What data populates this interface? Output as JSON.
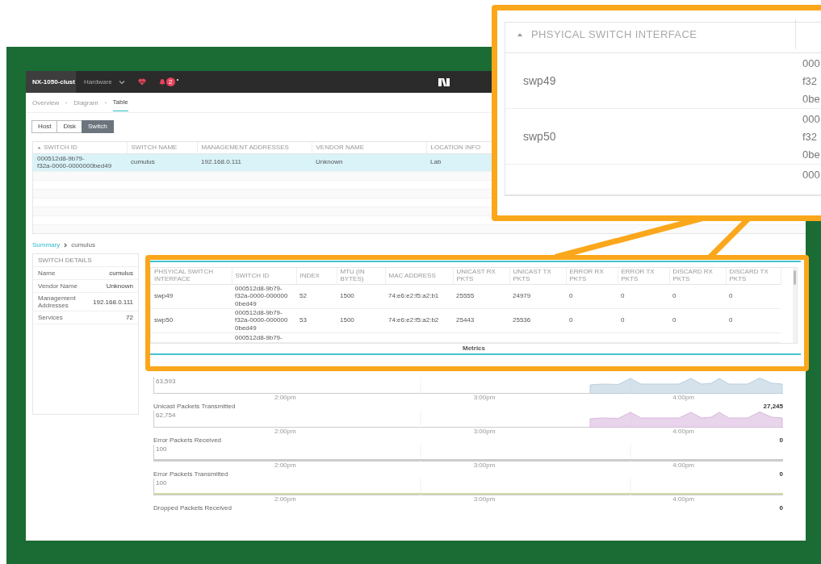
{
  "app": {
    "header": {
      "cluster": "NX-1050-clust",
      "menu": "Hardware",
      "alert_count": "2"
    },
    "tabs": [
      {
        "label": "Overview",
        "selected": false
      },
      {
        "label": "Diagram",
        "selected": false
      },
      {
        "label": "Table",
        "selected": true
      }
    ],
    "entity_buttons": [
      {
        "label": "Host",
        "selected": false
      },
      {
        "label": "Disk",
        "selected": false
      },
      {
        "label": "Switch",
        "selected": true
      }
    ],
    "switch_table": {
      "columns": [
        "SWITCH ID",
        "SWITCH NAME",
        "MANAGEMENT ADDRESSES",
        "VENDOR NAME",
        "LOCATION INFO"
      ],
      "rows": [
        {
          "selected": true,
          "cells": [
            [
              "000512d8-9b79-",
              "f32a-0000-0000000bed49"
            ],
            [
              "cumulus"
            ],
            [
              "192.168.0.111"
            ],
            [
              "Unknown"
            ],
            [
              "Lab"
            ]
          ]
        }
      ]
    },
    "breadcrumb": {
      "link": "Summary",
      "current": "cumulus"
    },
    "switch_details": {
      "title": "SWITCH DETAILS",
      "rows": [
        {
          "label": "Name",
          "value": "cumulus"
        },
        {
          "label": "Vendor Name",
          "value": "Unknown"
        },
        {
          "label": "Management Addresses",
          "value": "192.168.0.111"
        },
        {
          "label": "Services",
          "value": "72"
        }
      ]
    },
    "interface_table": {
      "columns": [
        "PHSYICAL SWITCH INTERFACE",
        "SWITCH ID",
        "INDEX",
        "MTU (IN BYTES)",
        "MAC ADDRESS",
        "UNICAST RX PKTS",
        "UNICAST TX PKTS",
        "ERROR RX PKTS",
        "ERROR TX PKTS",
        "DISCARD RX PKTS",
        "DISCARD TX PKTS"
      ],
      "rows": [
        {
          "cells": [
            [
              "swp49"
            ],
            [
              "000512d8-9b79-",
              "f32a-0000-000000",
              "0bed49"
            ],
            [
              "52"
            ],
            [
              "1500"
            ],
            [
              "74:e6:e2:f5:a2:b1"
            ],
            [
              "25555"
            ],
            [
              "24979"
            ],
            [
              "0"
            ],
            [
              "0"
            ],
            [
              "0"
            ],
            [
              "0"
            ]
          ]
        },
        {
          "cells": [
            [
              "swp50"
            ],
            [
              "000512d8-9b79-",
              "f32a-0000-000000",
              "0bed49"
            ],
            [
              "53"
            ],
            [
              "1500"
            ],
            [
              "74:e6:e2:f5:a2:b2"
            ],
            [
              "25443"
            ],
            [
              "25536"
            ],
            [
              "0"
            ],
            [
              "0"
            ],
            [
              "0"
            ],
            [
              "0"
            ]
          ]
        }
      ],
      "partial_row": {
        "switch_id": "000512d8-9b79-"
      }
    },
    "metrics_tab": "Metrics",
    "charts": [
      {
        "kind": "area",
        "color": "#b9cfdd",
        "max": "63,593",
        "times": [
          "2:00pm",
          "3:00pm",
          "4:00pm"
        ]
      },
      {
        "kind": "area",
        "color": "#d9b8dd",
        "title": "Unicast Packets Transmitted",
        "value": "27,245",
        "max": "62,754",
        "times": [
          "2:00pm",
          "3:00pm",
          "4:00pm"
        ]
      },
      {
        "kind": "flat",
        "color": "#cccccc",
        "title": "Error Packets Received",
        "value": "0",
        "max": "100",
        "times": [
          "2:00pm",
          "3:00pm",
          "4:00pm"
        ]
      },
      {
        "kind": "flat",
        "color": "#cfd9a8",
        "title": "Error Packets Transmitted",
        "value": "0",
        "max": "100",
        "times": [
          "2:00pm",
          "3:00pm",
          "4:00pm"
        ]
      },
      {
        "title": "Dropped Packets Received",
        "value": "0"
      }
    ]
  },
  "callout": {
    "header": "PHSYICAL SWITCH INTERFACE",
    "rows": [
      {
        "name": "swp49",
        "switch_id_lines": [
          "000",
          "f32",
          "0be"
        ]
      },
      {
        "name": "swp50",
        "switch_id_lines": [
          "000",
          "f32",
          "0be"
        ]
      }
    ],
    "partial_row": {
      "switch_id_lines": [
        "000"
      ]
    }
  }
}
